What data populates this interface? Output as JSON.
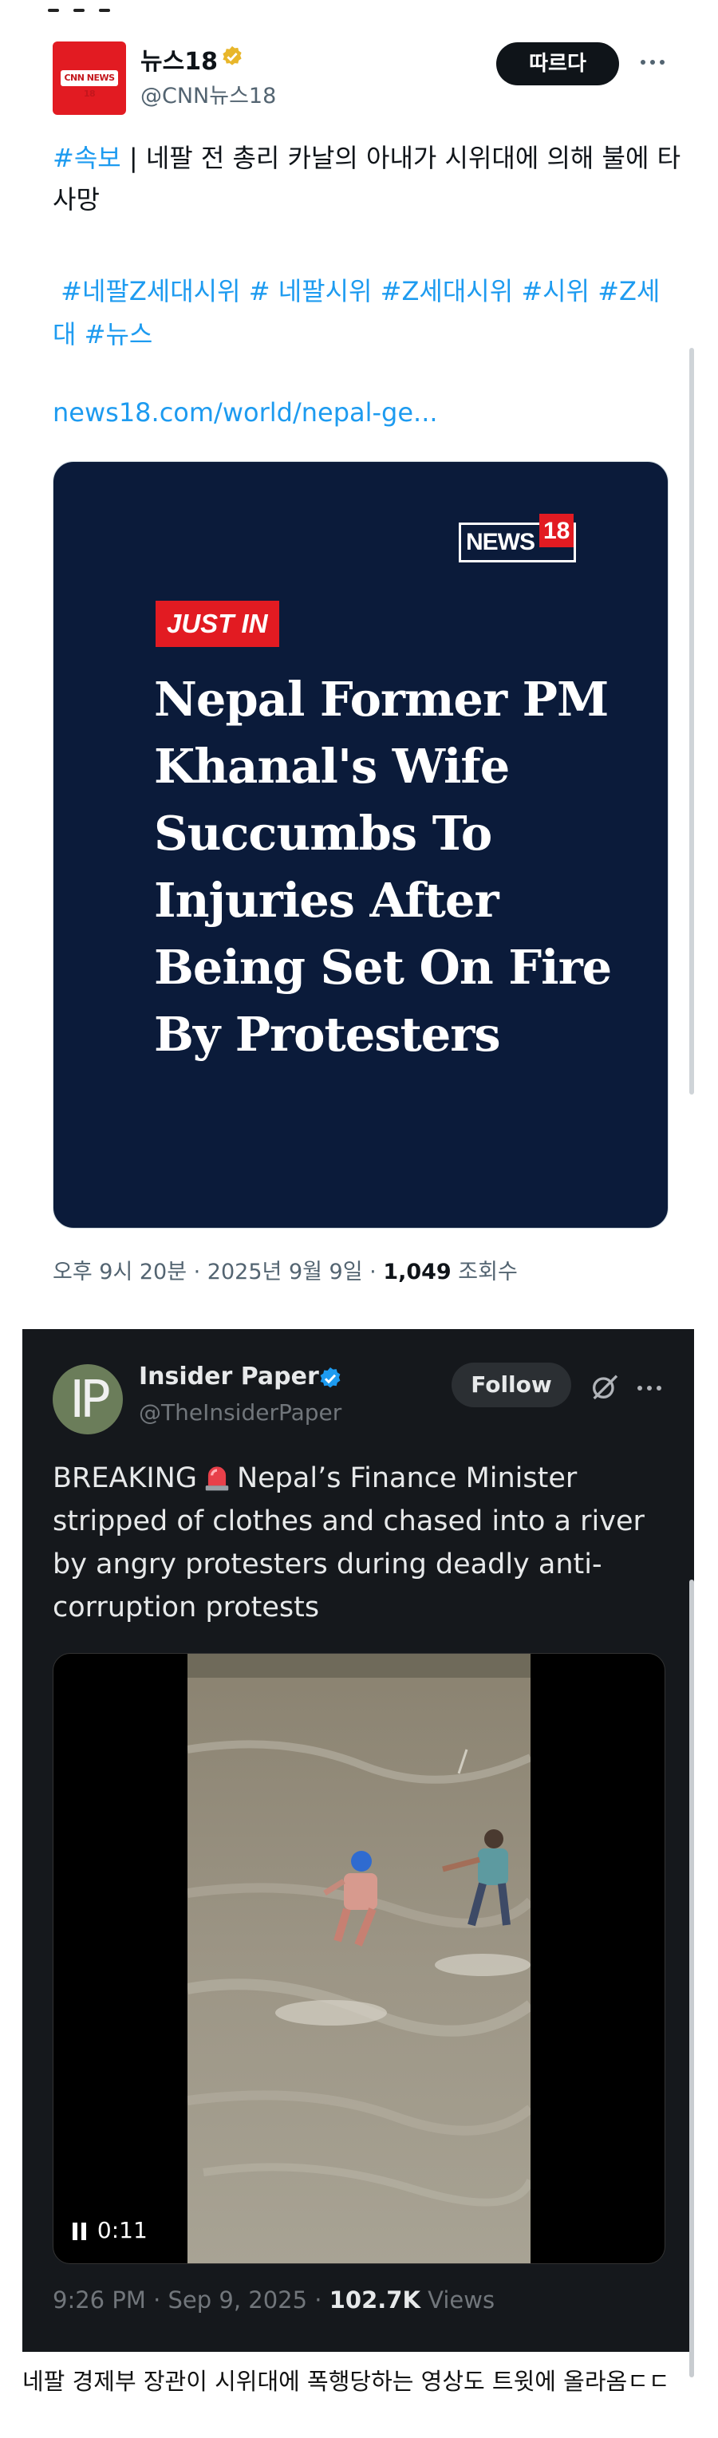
{
  "tweet1": {
    "display_name": "뉴스18",
    "handle": "@CNN뉴스18",
    "avatar_text": "CNN NEWS 18",
    "follow_label": "따르다",
    "text_tag": "#속보",
    "text_main": " | 네팔 전 총리 카날의 아내가 시위대에 의해 불에 타 사망",
    "hashtags": [
      "#네팔Z세대시위",
      "# 네팔시위",
      "#Z세대시위",
      "#시위",
      "#Z세대",
      "#뉴스"
    ],
    "link": "news18.com/world/nepal-ge...",
    "card": {
      "brand": "NEWS",
      "brand_num": "18",
      "badge": "JUST IN",
      "headline": [
        "Nepal Former PM",
        "Khanal's Wife",
        "Succumbs To",
        "Injuries After",
        "Being Set On Fire",
        "By Protesters"
      ]
    },
    "timestamp": "오후 9시 20분 · 2025년 9월 9일 · ",
    "views": "1,049",
    "views_label": " 조회수"
  },
  "tweet2": {
    "display_name": "Insider Paper",
    "handle": "@TheInsiderPaper",
    "avatar_text": "IP",
    "follow_label": "Follow",
    "text_before": "BREAKING",
    "text_after": "Nepal’s Finance Minister stripped of clothes and chased into a river by angry protesters during deadly anti-corruption protests",
    "video_time": "0:11",
    "timestamp": "9:26 PM · Sep 9, 2025 · ",
    "views": "102.7K",
    "views_label": " Views"
  },
  "caption": "네팔 경제부 장관이 시위대에 폭행당하는 영상도 트윗에 올라옴ㄷㄷ",
  "colors": {
    "x_blue": "#1d9bf0",
    "news18_red": "#e21b22",
    "card_navy": "#0b1b3a",
    "dark_bg": "#15181c"
  }
}
